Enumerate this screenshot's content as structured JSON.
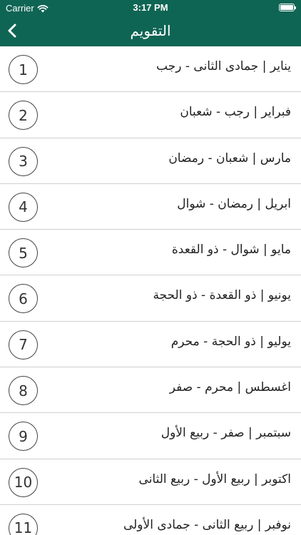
{
  "status_bar": {
    "carrier": "Carrier",
    "time": "3:17 PM"
  },
  "nav": {
    "title": "التقويم",
    "back_icon": "chevron-left-icon"
  },
  "colors": {
    "header": "#0f6554",
    "divider": "#d0d0d0"
  },
  "months": [
    {
      "number": "1",
      "label": "يناير | جمادى الثانى - رجب"
    },
    {
      "number": "2",
      "label": "فبراير | رجب - شعبان"
    },
    {
      "number": "3",
      "label": "مارس | شعبان - رمضان"
    },
    {
      "number": "4",
      "label": "ابريل | رمضان - شوال"
    },
    {
      "number": "5",
      "label": "مايو | شوال - ذو القعدة"
    },
    {
      "number": "6",
      "label": "يونيو | ذو القعدة - ذو الحجة"
    },
    {
      "number": "7",
      "label": "يوليو | ذو الحجة - محرم"
    },
    {
      "number": "8",
      "label": "اغسطس | محرم - صفر"
    },
    {
      "number": "9",
      "label": "سبتمبر | صفر - ربيع الأول"
    },
    {
      "number": "10",
      "label": "اكتوبر | ربيع الأول - ربيع الثانى"
    },
    {
      "number": "11",
      "label": "نوفبر | ربيع الثانى - جمادى الأولى"
    }
  ]
}
